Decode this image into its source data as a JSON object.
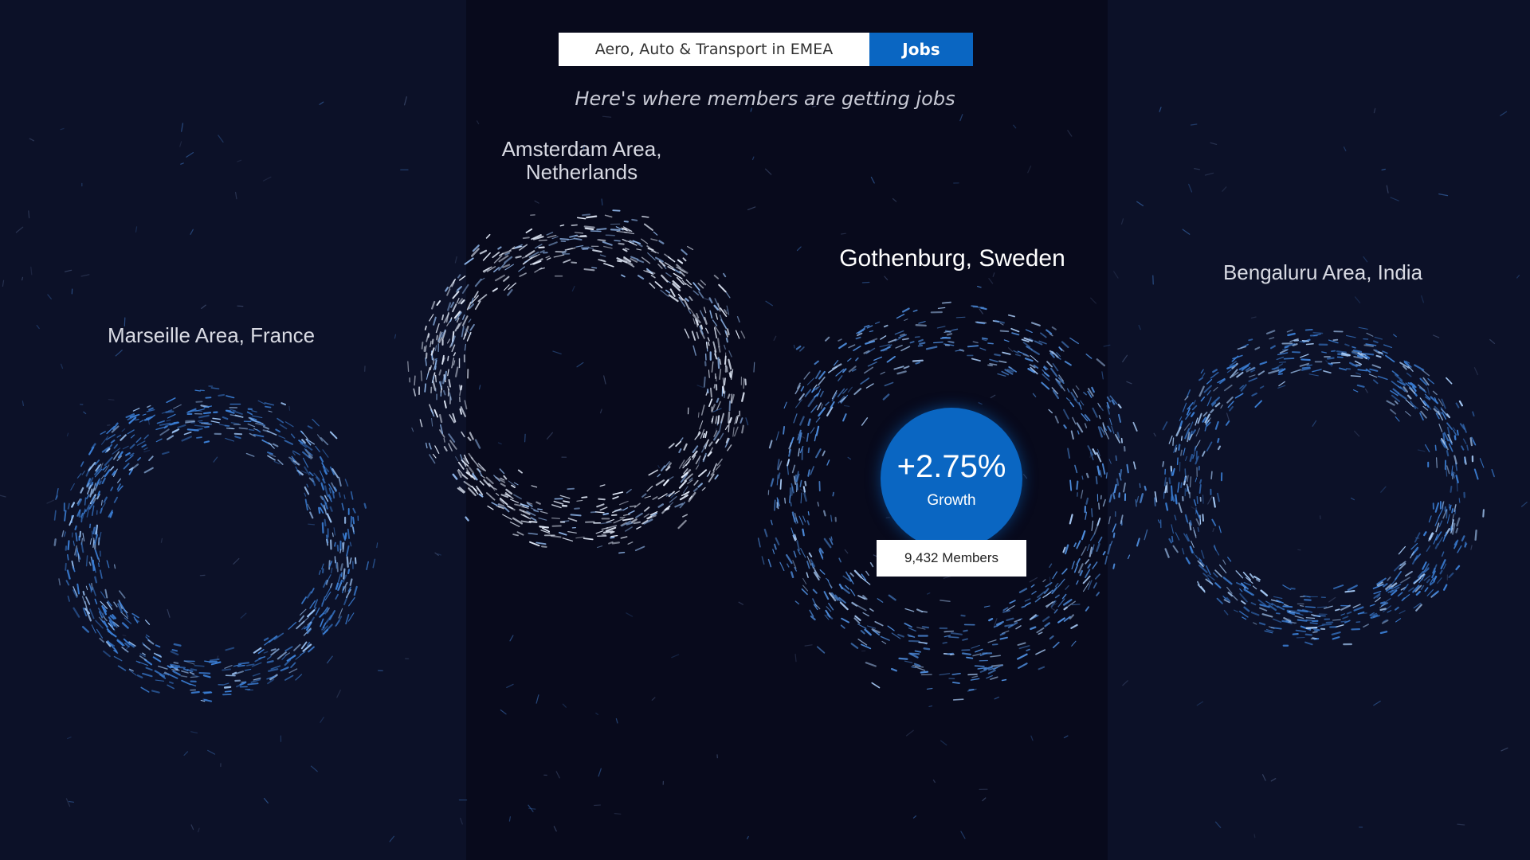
{
  "search": {
    "query": "Aero, Auto & Transport in EMEA",
    "button_label": "Jobs"
  },
  "subtitle": "Here's where members are getting jobs",
  "locations": [
    {
      "name": "Marseille Area, France",
      "ring_color": "#3b7fd6"
    },
    {
      "name": "Amsterdam Area, Netherlands",
      "ring_color": "#e6eefc"
    },
    {
      "name": "Gothenburg, Sweden",
      "ring_color": "#4f8fe0"
    },
    {
      "name": "Bengaluru Area, India",
      "ring_color": "#3b7fd6"
    }
  ],
  "highlight": {
    "growth_value": "+2.75%",
    "growth_label": "Growth",
    "members": "9,432 Members",
    "color": "#0a66c2"
  }
}
